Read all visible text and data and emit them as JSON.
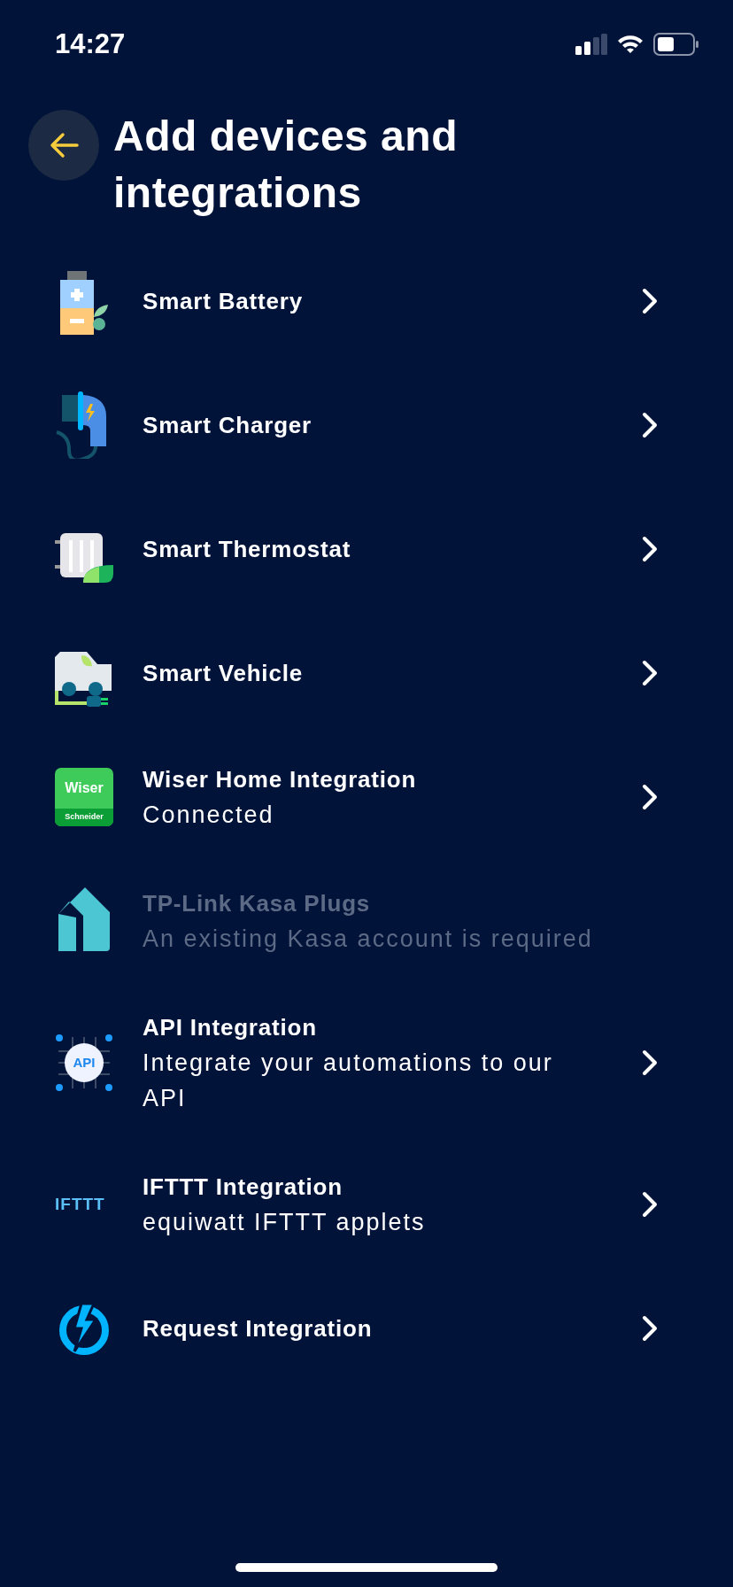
{
  "status_bar": {
    "time": "14:27"
  },
  "header": {
    "title": "Add devices and integrations"
  },
  "items": [
    {
      "kind": "battery",
      "title": "Smart Battery",
      "disabled": false
    },
    {
      "kind": "charger",
      "title": "Smart Charger",
      "disabled": false
    },
    {
      "kind": "thermostat",
      "title": "Smart Thermostat",
      "disabled": false
    },
    {
      "kind": "vehicle",
      "title": "Smart Vehicle",
      "disabled": false
    },
    {
      "kind": "wiser",
      "title": "Wiser Home Integration",
      "subtitle": "Connected",
      "logo_text": "Wiser",
      "logo_subtext": "Schneider",
      "disabled": false
    },
    {
      "kind": "kasa",
      "title": "TP-Link Kasa Plugs",
      "subtitle": "An existing Kasa account is required",
      "disabled": true
    },
    {
      "kind": "api",
      "title": "API Integration",
      "subtitle": "Integrate your automations to our API",
      "logo_text": "API",
      "disabled": false
    },
    {
      "kind": "ifttt",
      "title": "IFTTT Integration",
      "subtitle": "equiwatt IFTTT applets",
      "logo_text": "IFTTT",
      "disabled": false
    },
    {
      "kind": "request",
      "title": "Request Integration",
      "disabled": false
    }
  ]
}
